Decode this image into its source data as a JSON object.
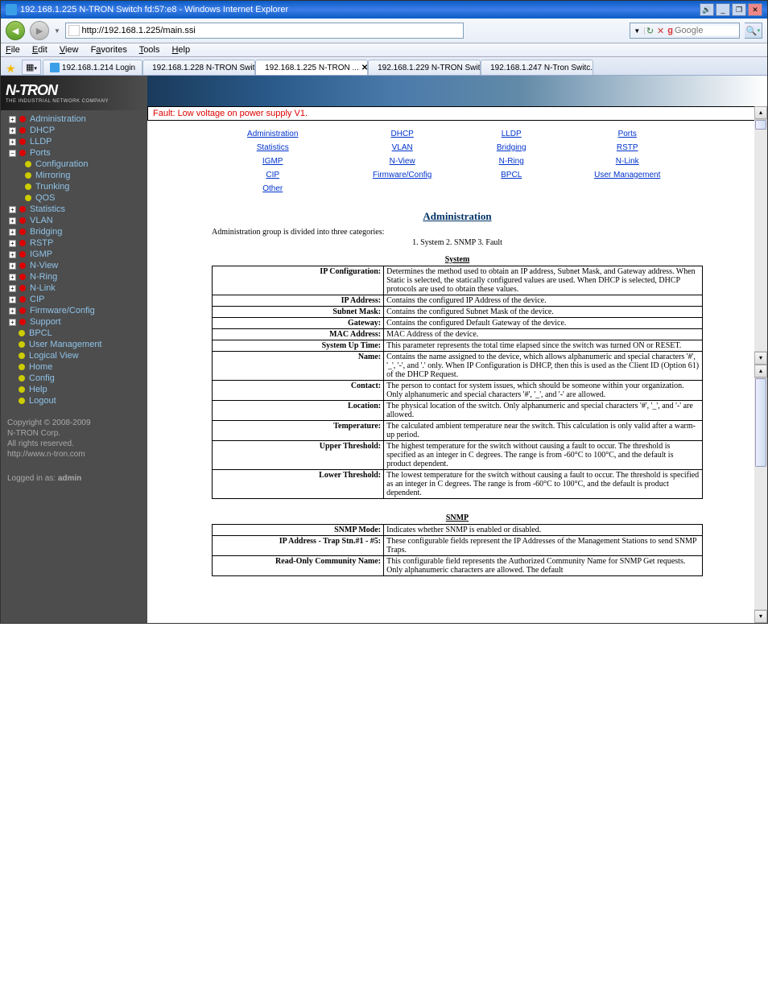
{
  "window": {
    "title": "192.168.1.225 N-TRON Switch fd:57:e8 - Windows Internet Explorer"
  },
  "address": {
    "url": "http://192.168.1.225/main.ssi"
  },
  "search": {
    "placeholder": "Google"
  },
  "menus": {
    "file": "File",
    "edit": "Edit",
    "view": "View",
    "fav": "Favorites",
    "tools": "Tools",
    "help": "Help"
  },
  "tabs": {
    "t0": "192.168.1.214 Login",
    "t1": "192.168.1.228 N-TRON Swit...",
    "t2": "192.168.1.225 N-TRON ...",
    "t3": "192.168.1.229 N-TRON Swit...",
    "t4": "192.168.1.247 N-Tron Switc..."
  },
  "logo": {
    "text": "N-TRON",
    "sub": "THE INDUSTRIAL NETWORK COMPANY"
  },
  "nav": {
    "admin": "Administration",
    "dhcp": "DHCP",
    "lldp": "LLDP",
    "ports": "Ports",
    "config": "Configuration",
    "mirror": "Mirroring",
    "trunk": "Trunking",
    "qos": "QOS",
    "stats": "Statistics",
    "vlan": "VLAN",
    "bridging": "Bridging",
    "rstp": "RSTP",
    "igmp": "IGMP",
    "nview": "N-View",
    "nring": "N-Ring",
    "nlink": "N-Link",
    "cip": "CIP",
    "fw": "Firmware/Config",
    "support": "Support",
    "bpcl": "BPCL",
    "um": "User Management",
    "lv": "Logical View",
    "home": "Home",
    "cfg": "Config",
    "help": "Help",
    "logout": "Logout"
  },
  "copyright": {
    "l1": "Copyright © 2008-2009",
    "l2": "N-TRON Corp.",
    "l3": "All rights reserved.",
    "l4": "http://www.n-tron.com"
  },
  "logged": {
    "label": "Logged in as: ",
    "user": "admin"
  },
  "fault": "Fault:  Low voltage on power supply V1.",
  "links": {
    "r1c1": "Administration",
    "r1c2": "DHCP",
    "r1c3": "LLDP",
    "r1c4": "Ports",
    "r2c1": "Statistics",
    "r2c2": "VLAN",
    "r2c3": "Bridging",
    "r2c4": "RSTP",
    "r3c1": "IGMP",
    "r3c2": "N-View",
    "r3c3": "N-Ring",
    "r3c4": "N-Link",
    "r4c1": "CIP",
    "r4c2": "Firmware/Config",
    "r4c3": "BPCL",
    "r4c4": "User Management",
    "r5c1": "Other"
  },
  "section": {
    "title": "Administration",
    "desc": "Administration group is divided into three categories:",
    "desc2": "1. System   2. SNMP   3. Fault"
  },
  "system": {
    "head": "System",
    "k1": "IP Configuration:",
    "v1": "Determines the method used to obtain an IP address, Subnet Mask, and Gateway address. When Static is selected, the statically configured values are used. When DHCP is selected, DHCP protocols are used to obtain these values.",
    "k2": "IP Address:",
    "v2": "Contains the configured IP Address of the device.",
    "k3": "Subnet Mask:",
    "v3": "Contains the configured Subnet Mask of the device.",
    "k4": "Gateway:",
    "v4": "Contains the configured Default Gateway of the device.",
    "k5": "MAC Address:",
    "v5": "MAC Address of the device.",
    "k6": "System Up Time:",
    "v6": "This parameter represents the total time elapsed since the switch was turned ON or RESET.",
    "k7": "Name:",
    "v7": "Contains the name assigned to the device, which allows alphanumeric and special characters '#', '_', '-', and '.' only. When IP Configuration is DHCP, then this is used as the Client ID (Option 61) of the DHCP Request.",
    "k8": "Contact:",
    "v8": "The person to contact for system issues, which should be someone within your organization. Only alphanumeric and special characters '#', '_', and '-' are allowed.",
    "k9": "Location:",
    "v9": "The physical location of the switch. Only alphanumeric and special characters '#', '_', and '-' are allowed.",
    "k10": "Temperature:",
    "v10": "The calculated ambient temperature near the switch. This calculation is only valid after a warm-up period.",
    "k11": "Upper Threshold:",
    "v11": "The highest temperature for the switch without causing a fault to occur. The threshold is specified as an integer in C degrees. The range is from -60°C to 100°C, and the default is product dependent.",
    "k12": "Lower Threshold:",
    "v12": "The lowest temperature for the switch without causing a fault to occur. The threshold is specified as an integer in C degrees. The range is from -60°C to 100°C, and the default is product dependent."
  },
  "snmp": {
    "head": "SNMP",
    "k1": "SNMP Mode:",
    "v1": "Indicates whether SNMP is enabled or disabled.",
    "k2": "IP Address - Trap Stn.#1 - #5:",
    "v2": "These configurable fields represent the IP Addresses of the Management Stations to send SNMP Traps.",
    "k3": "Read-Only Community Name:",
    "v3": "This configurable field represents the Authorized Community Name for SNMP Get requests. Only alphanumeric characters are allowed. The default"
  }
}
